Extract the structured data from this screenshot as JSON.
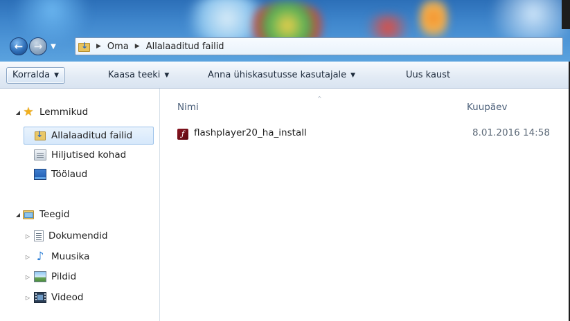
{
  "window": {
    "nav": {
      "back_glyph": "←",
      "forward_glyph": "→",
      "history_caret": "▼"
    },
    "breadcrumb": [
      {
        "label": "Oma"
      },
      {
        "label": "Allalaaditud failid"
      }
    ],
    "breadcrumb_separator": "▶",
    "accent": "#3f86cc"
  },
  "toolbar": {
    "organize_label": "Korralda",
    "include_library_label": "Kaasa teeki",
    "share_label": "Anna ühiskasutusse kasutajale",
    "new_folder_label": "Uus kaust",
    "caret": "▼"
  },
  "sidebar": {
    "favorites": {
      "label": "Lemmikud",
      "items": [
        {
          "label": "Allalaaditud failid",
          "icon": "downloads-folder-icon",
          "selected": true
        },
        {
          "label": "Hiljutised kohad",
          "icon": "recent-places-icon"
        },
        {
          "label": "Töölaud",
          "icon": "desktop-icon"
        }
      ]
    },
    "libraries": {
      "label": "Teegid",
      "items": [
        {
          "label": "Dokumendid",
          "icon": "documents-icon"
        },
        {
          "label": "Muusika",
          "icon": "music-icon"
        },
        {
          "label": "Pildid",
          "icon": "pictures-icon"
        },
        {
          "label": "Videod",
          "icon": "videos-icon"
        }
      ]
    },
    "expanded_glyph": "◢",
    "collapsed_glyph": "▷"
  },
  "content": {
    "columns": {
      "name": "Nimi",
      "date": "Kuupäev"
    },
    "sort_indicator": "^",
    "files": [
      {
        "name": "flashplayer20_ha_install",
        "date": "8.01.2016 14:58",
        "icon": "flash-installer-icon"
      }
    ]
  }
}
